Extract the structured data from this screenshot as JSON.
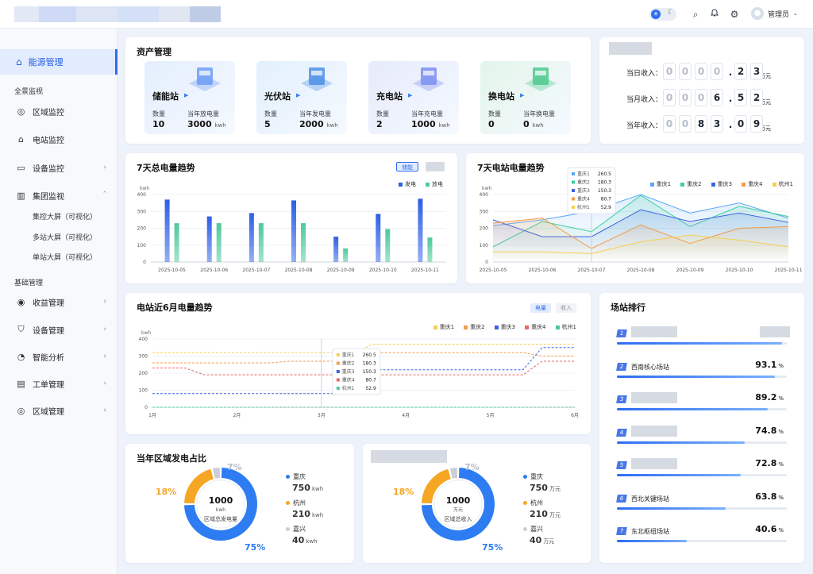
{
  "header": {
    "user": "管理员"
  },
  "sidebar": {
    "active": "能源管理",
    "section1": "全景监视",
    "section2": "基础管理",
    "items1": [
      "区域监控",
      "电站监控",
      "设备监控",
      "集团监视"
    ],
    "subitems": [
      "集控大屏（可视化）",
      "多站大屏（可视化）",
      "单站大屏（可视化）"
    ],
    "items2": [
      "收益管理",
      "设备管理",
      "智能分析",
      "工单管理",
      "区域管理"
    ]
  },
  "assets": {
    "title": "资产管理",
    "cards": [
      {
        "name": "储能站",
        "l1": "数量",
        "v1": "10",
        "l2": "当年放电量",
        "v2": "3000",
        "unit": "kwh",
        "color": "#e4eefd"
      },
      {
        "name": "光伏站",
        "l1": "数量",
        "v1": "5",
        "l2": "当年发电量",
        "v2": "2000",
        "unit": "kwh",
        "color": "#e2f0fc"
      },
      {
        "name": "充电站",
        "l1": "数量",
        "v1": "2",
        "l2": "当年充电量",
        "v2": "1000",
        "unit": "kwh",
        "color": "#e6ebfb"
      },
      {
        "name": "换电站",
        "l1": "数量",
        "v1": "0",
        "l2": "当年换电量",
        "v2": "0",
        "unit": "kwh",
        "color": "#e3f5ea"
      }
    ]
  },
  "income": {
    "rows": [
      {
        "label": "当日收入：",
        "digits": [
          "0",
          "0",
          "0",
          "0",
          ".",
          "2",
          "3"
        ],
        "unit": "万元"
      },
      {
        "label": "当月收入：",
        "digits": [
          "0",
          "0",
          "0",
          "6",
          ".",
          "5",
          "2"
        ],
        "unit": "万元"
      },
      {
        "label": "当年收入：",
        "digits": [
          "0",
          "0",
          "8",
          "3",
          ".",
          "0",
          "9"
        ],
        "unit": "万元"
      }
    ]
  },
  "chart7day": {
    "title": "7天总电量趋势",
    "chip": "储能"
  },
  "chart7station": {
    "title": "7天电站电量趋势"
  },
  "chart6m": {
    "title": "电站近6月电量趋势",
    "chip1": "电量",
    "chip2": "收入"
  },
  "ranking": {
    "title": "场站排行",
    "rows": [
      {
        "rank": "1",
        "name": "",
        "value": null,
        "fill": 0.97,
        "blur": true
      },
      {
        "rank": "2",
        "name": "西南核心场站",
        "value": "93.1",
        "fill": 0.93
      },
      {
        "rank": "3",
        "name": "",
        "value": "89.2",
        "fill": 0.89,
        "blur": true
      },
      {
        "rank": "4",
        "name": "",
        "value": "74.8",
        "fill": 0.75,
        "blur": true
      },
      {
        "rank": "5",
        "name": "",
        "value": "72.8",
        "fill": 0.73,
        "blur": true
      },
      {
        "rank": "6",
        "name": "西北关键场站",
        "value": "63.8",
        "fill": 0.64
      },
      {
        "rank": "7",
        "name": "东北枢纽场站",
        "value": "40.6",
        "fill": 0.41
      }
    ],
    "unit": "%"
  },
  "donut1": {
    "title": "当年区域发电占比",
    "center_value": "1000",
    "center_unit": "kwh",
    "center_label": "区域总发电量",
    "legend": [
      {
        "name": "重庆",
        "value": "750",
        "unit": "kwh",
        "color": "#2d7cf2"
      },
      {
        "name": "杭州",
        "value": "210",
        "unit": "kwh",
        "color": "#f5a623"
      },
      {
        "name": "嘉兴",
        "value": "40",
        "unit": "kwh",
        "color": "#c9ced8"
      }
    ],
    "pcts": [
      "7%",
      "18%",
      "75%"
    ]
  },
  "donut2": {
    "center_value": "1000",
    "center_unit": "万元",
    "center_label": "区域总收入",
    "legend": [
      {
        "name": "重庆",
        "value": "750",
        "unit": "万元",
        "color": "#2d7cf2"
      },
      {
        "name": "杭州",
        "value": "210",
        "unit": "万元",
        "color": "#f5a623"
      },
      {
        "name": "嘉兴",
        "value": "40",
        "unit": "万元",
        "color": "#c9ced8"
      }
    ],
    "pcts": [
      "7%",
      "18%",
      "75%"
    ]
  },
  "chart_data": [
    {
      "type": "bar",
      "title": "7天总电量趋势",
      "ylabel": "kwh",
      "ylim": [
        0,
        400
      ],
      "yticks": [
        "0",
        "100",
        "200",
        "300",
        "400"
      ],
      "categories": [
        "2025-10-05",
        "2025-10-06",
        "2025-10-07",
        "2025-10-08",
        "2025-10-09",
        "2025-10-10",
        "2025-10-11"
      ],
      "series": [
        {
          "name": "发电",
          "values": [
            370,
            270,
            290,
            365,
            150,
            285,
            375
          ],
          "color": "#2d5fe6"
        },
        {
          "name": "放电",
          "values": [
            230,
            230,
            230,
            230,
            80,
            195,
            145
          ],
          "color": "#4cc99a"
        }
      ],
      "legend": "top-right"
    },
    {
      "type": "line",
      "title": "7天电站电量趋势",
      "ylabel": "kwh",
      "ylim": [
        0,
        400
      ],
      "yticks": [
        "0",
        "100",
        "200",
        "300",
        "400"
      ],
      "categories": [
        "2025-10-05",
        "2025-10-06",
        "2025-10-07",
        "2025-10-08",
        "2025-10-09",
        "2025-10-10",
        "2025-10-11"
      ],
      "series": [
        {
          "name": "重庆1",
          "values": [
            215,
            250,
            300,
            400,
            290,
            350,
            260
          ],
          "color": "#5aa8f5"
        },
        {
          "name": "重庆2",
          "values": [
            90,
            240,
            180,
            395,
            210,
            330,
            270
          ],
          "color": "#3ccf9d"
        },
        {
          "name": "重庆3",
          "values": [
            250,
            150,
            150,
            310,
            240,
            290,
            235
          ],
          "color": "#3f63e0"
        },
        {
          "name": "重庆4",
          "values": [
            230,
            260,
            80,
            220,
            110,
            200,
            210
          ],
          "color": "#f39a4a"
        },
        {
          "name": "杭州1",
          "values": [
            60,
            60,
            50,
            120,
            160,
            130,
            90
          ],
          "color": "#f5cf52"
        }
      ],
      "tooltip": {
        "category": "2025-10-07",
        "items": [
          [
            "重庆1",
            "260.5"
          ],
          [
            "重庆2",
            "180.3"
          ],
          [
            "重庆3",
            "150.3"
          ],
          [
            "重庆4",
            "80.7"
          ],
          [
            "杭州1",
            "52.9"
          ]
        ]
      },
      "legend": "top-right"
    },
    {
      "type": "line",
      "title": "电站近6月电量趋势",
      "ylabel": "kwh",
      "ylim": [
        0,
        400
      ],
      "yticks": [
        "0",
        "100",
        "200",
        "300",
        "400"
      ],
      "categories": [
        "1月",
        "2月",
        "3月",
        "4月",
        "5月",
        "6月"
      ],
      "series": [
        {
          "name": "重庆1",
          "values": [
            320,
            320,
            320,
            370,
            370,
            370
          ],
          "color": "#f5cf52"
        },
        {
          "name": "重庆2",
          "values": [
            260,
            260,
            270,
            320,
            320,
            300
          ],
          "color": "#f39a4a"
        },
        {
          "name": "重庆3",
          "values": [
            80,
            80,
            80,
            220,
            220,
            350
          ],
          "color": "#3f63e0"
        },
        {
          "name": "重庆4",
          "values": [
            230,
            190,
            190,
            190,
            190,
            270
          ],
          "color": "#e86a6a"
        },
        {
          "name": "杭州1",
          "values": [
            0,
            0,
            0,
            0,
            0,
            0
          ],
          "color": "#4cc99a"
        }
      ],
      "tooltip": {
        "category": "3月",
        "items": [
          [
            "重庆1",
            "260.5"
          ],
          [
            "重庆2",
            "180.3"
          ],
          [
            "重庆3",
            "150.3"
          ],
          [
            "重庆4",
            "80.7"
          ],
          [
            "杭州1",
            "52.9"
          ]
        ]
      },
      "legend": "top-right"
    },
    {
      "type": "pie",
      "title": "当年区域发电占比",
      "categories": [
        "重庆",
        "杭州",
        "嘉兴"
      ],
      "values": [
        750,
        210,
        40
      ]
    },
    {
      "type": "pie",
      "title": "",
      "categories": [
        "重庆",
        "杭州",
        "嘉兴"
      ],
      "values": [
        750,
        210,
        40
      ]
    }
  ]
}
